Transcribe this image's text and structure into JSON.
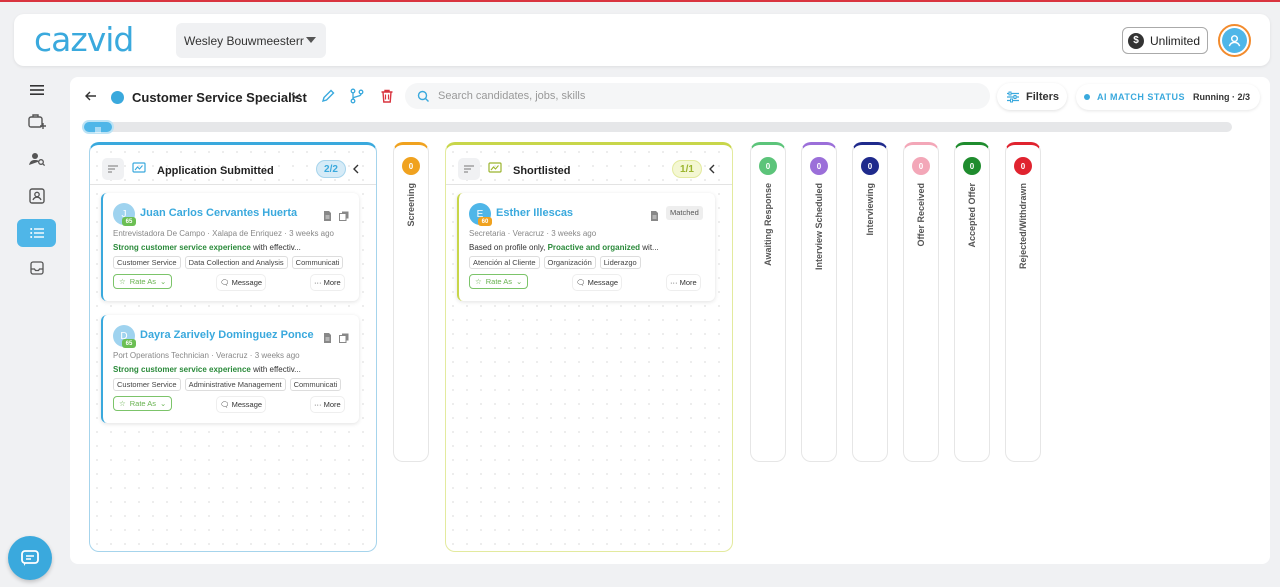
{
  "app": {
    "logo": "cazvid",
    "user_name": "Wesley Bouwmeesterr",
    "plan_label": "Unlimited",
    "plan_icon": "$"
  },
  "sidebar": {
    "items": [
      {
        "name": "menu-icon"
      },
      {
        "name": "add-job-icon"
      },
      {
        "name": "find-candidates-icon"
      },
      {
        "name": "contacts-icon"
      },
      {
        "name": "pipeline-list-icon",
        "active": true
      },
      {
        "name": "inbox-icon"
      }
    ]
  },
  "header": {
    "job_title": "Customer Service Specialist",
    "search_placeholder": "Search candidates, jobs, skills",
    "filters_label": "Filters",
    "ai_status_label": "AI MATCH STATUS",
    "ai_status_value": "Running · 2/3"
  },
  "columns": {
    "applied": {
      "title": "Application Submitted",
      "count": "2/2",
      "color": "#3aa9dd",
      "cards": [
        {
          "initial": "J",
          "score": "65",
          "name": "Juan Carlos Cervantes Huerta",
          "meta": "Entrevistadora De Campo · Xalapa de Enriquez · 3 weeks ago",
          "desc_hl": "Strong customer service experience",
          "desc_rest": " with effectiv...",
          "tags": [
            "Customer Service",
            "Data Collection and Analysis",
            "Communicati"
          ],
          "rate_label": "Rate As",
          "message_label": "Message",
          "more_label": "More"
        },
        {
          "initial": "D",
          "score": "65",
          "name": "Dayra Zarively Dominguez Ponce",
          "meta": "Port Operations Technician · Veracruz · 3 weeks ago",
          "desc_hl": "Strong customer service experience",
          "desc_rest": " with effectiv...",
          "tags": [
            "Customer Service",
            "Administrative Management",
            "Communicati"
          ],
          "rate_label": "Rate As",
          "message_label": "Message",
          "more_label": "More"
        }
      ]
    },
    "screening": {
      "title": "Screening",
      "count": "0",
      "color": "#f0a21f"
    },
    "shortlisted": {
      "title": "Shortlisted",
      "count": "1/1",
      "color": "#c8d64a",
      "cards": [
        {
          "initial": "E",
          "score": "60",
          "name": "Esther Illescas",
          "matched": "Matched",
          "meta": "Secretaria · Veracruz · 3 weeks ago",
          "desc_pre": "Based on profile only, ",
          "desc_hl": "Proactive and organized",
          "desc_rest": " wit...",
          "tags": [
            "Atención al Cliente",
            "Organización",
            "Liderazgo"
          ],
          "rate_label": "Rate As",
          "message_label": "Message",
          "more_label": "More"
        }
      ]
    },
    "narrow": [
      {
        "title": "Awaiting Response",
        "count": "0",
        "color": "#5cc47a"
      },
      {
        "title": "Interview Scheduled",
        "count": "0",
        "color": "#9b6fd9"
      },
      {
        "title": "Interviewing",
        "count": "0",
        "color": "#1f2a8c"
      },
      {
        "title": "Offer Received",
        "count": "0",
        "color": "#f3a7b8"
      },
      {
        "title": "Accepted Offer",
        "count": "0",
        "color": "#1f8c2e"
      },
      {
        "title": "Rejected/Withdrawn",
        "count": "0",
        "color": "#e0232f"
      }
    ]
  }
}
